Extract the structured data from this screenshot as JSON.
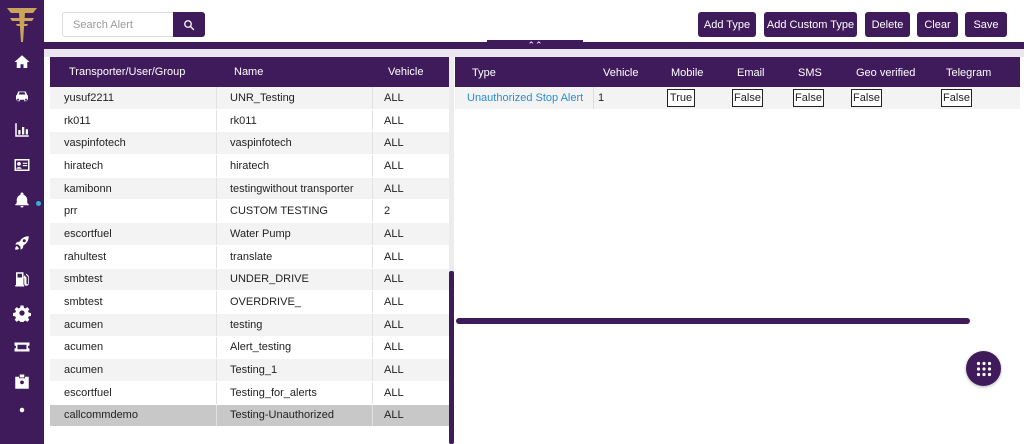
{
  "toolbar": {
    "search_placeholder": "Search Alert",
    "add_type": "Add Type",
    "add_custom_type": "Add Custom Type",
    "delete": "Delete",
    "clear": "Clear",
    "save": "Save"
  },
  "collapse_icon": "double-chevron-up-icon",
  "sidebar": {
    "icons": [
      "home-icon",
      "car-icon",
      "bar-chart-icon",
      "id-card-icon",
      "bell-icon",
      "rocket-icon",
      "fuel-pump-icon",
      "gear-icon",
      "ticket-icon",
      "badge-icon"
    ],
    "active": "bell-icon"
  },
  "left_table": {
    "headers": [
      "Transporter/User/Group",
      "Name",
      "Vehicle"
    ],
    "rows": [
      [
        "yusuf2211",
        "UNR_Testing",
        "ALL"
      ],
      [
        "rk011",
        "rk011",
        "ALL"
      ],
      [
        "vaspinfotech",
        "vaspinfotech",
        "ALL"
      ],
      [
        "hiratech",
        "hiratech",
        "ALL"
      ],
      [
        "kamibonn",
        "testingwithout transporter",
        "ALL"
      ],
      [
        "prr",
        "CUSTOM TESTING",
        "2"
      ],
      [
        "escortfuel",
        "Water Pump",
        "ALL"
      ],
      [
        "rahultest",
        "translate",
        "ALL"
      ],
      [
        "smbtest",
        "UNDER_DRIVE",
        "ALL"
      ],
      [
        "smbtest",
        "OVERDRIVE_",
        "ALL"
      ],
      [
        "acumen",
        "testing",
        "ALL"
      ],
      [
        "acumen",
        "Alert_testing",
        "ALL"
      ],
      [
        "acumen",
        "Testing_1",
        "ALL"
      ],
      [
        "escortfuel",
        "Testing_for_alerts",
        "ALL"
      ],
      [
        "callcommdemo",
        "Testing-Unauthorized",
        "ALL"
      ]
    ],
    "selected_row": 14
  },
  "right_table": {
    "headers": [
      "Type",
      "Vehicle",
      "Mobile",
      "Email",
      "SMS",
      "Geo verified",
      "Telegram"
    ],
    "rows": [
      {
        "type": "Unauthorized Stop Alert",
        "vehicle": "1",
        "mobile": "True",
        "email": "False",
        "sms": "False",
        "geo": "False",
        "telegram": "False"
      }
    ]
  },
  "colors": {
    "primary": "#3f1b5c",
    "link": "#2a8fd0",
    "notify_dot": "#2fb3d8"
  },
  "fab_icon": "grid-apps-icon"
}
